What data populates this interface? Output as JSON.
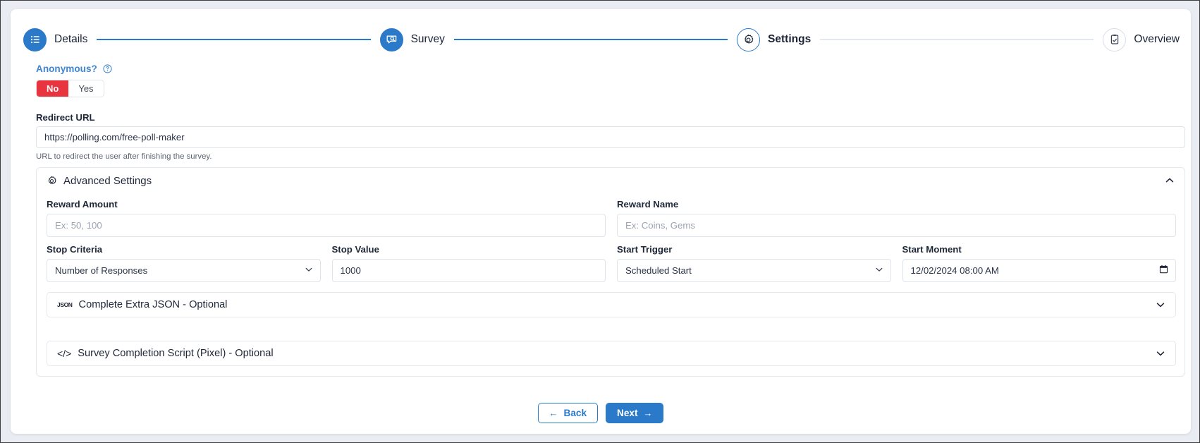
{
  "stepper": {
    "steps": [
      {
        "label": "Details",
        "icon": "list-icon",
        "state": "done"
      },
      {
        "label": "Survey",
        "icon": "survey-search-icon",
        "state": "done"
      },
      {
        "label": "Settings",
        "icon": "gear-icon",
        "state": "current"
      },
      {
        "label": "Overview",
        "icon": "clipboard-check-icon",
        "state": "todo"
      }
    ],
    "connector_filled_color": "#2b7ac9",
    "connector_empty_color": "#e3e7ee"
  },
  "anonymous": {
    "label": "Anonymous?",
    "help_icon": "question-circle-icon",
    "options": [
      "No",
      "Yes"
    ],
    "selected": "No",
    "selected_color": "#e8343f"
  },
  "redirect": {
    "label": "Redirect URL",
    "value": "https://polling.com/free-poll-maker",
    "placeholder": "",
    "help": "URL to redirect the user after finishing the survey."
  },
  "advanced": {
    "title": "Advanced Settings",
    "icon": "gear-icon",
    "expanded": true,
    "chevron": "chevron-up-icon",
    "reward_amount": {
      "label": "Reward Amount",
      "value": "",
      "placeholder": "Ex: 50, 100"
    },
    "reward_name": {
      "label": "Reward Name",
      "value": "",
      "placeholder": "Ex: Coins, Gems"
    },
    "stop_criteria": {
      "label": "Stop Criteria",
      "value": "Number of Responses",
      "options": [
        "Number of Responses"
      ]
    },
    "stop_value": {
      "label": "Stop Value",
      "value": "1000",
      "placeholder": ""
    },
    "start_trigger": {
      "label": "Start Trigger",
      "value": "Scheduled Start",
      "options": [
        "Scheduled Start"
      ]
    },
    "start_moment": {
      "label": "Start Moment",
      "value": "12/02/2024 08:00 AM",
      "icon": "calendar-icon"
    },
    "json_section": {
      "title": "Complete Extra JSON - Optional",
      "icon": "json-icon",
      "chevron": "chevron-down-icon",
      "glyph": "JSON"
    },
    "pixel_section": {
      "title": "Survey Completion Script (Pixel) - Optional",
      "icon": "code-icon",
      "chevron": "chevron-down-icon",
      "glyph": "</>"
    }
  },
  "footer": {
    "back_label": "Back",
    "back_arrow": "←",
    "next_label": "Next",
    "next_arrow": "→",
    "primary_color": "#2b7ac9"
  }
}
